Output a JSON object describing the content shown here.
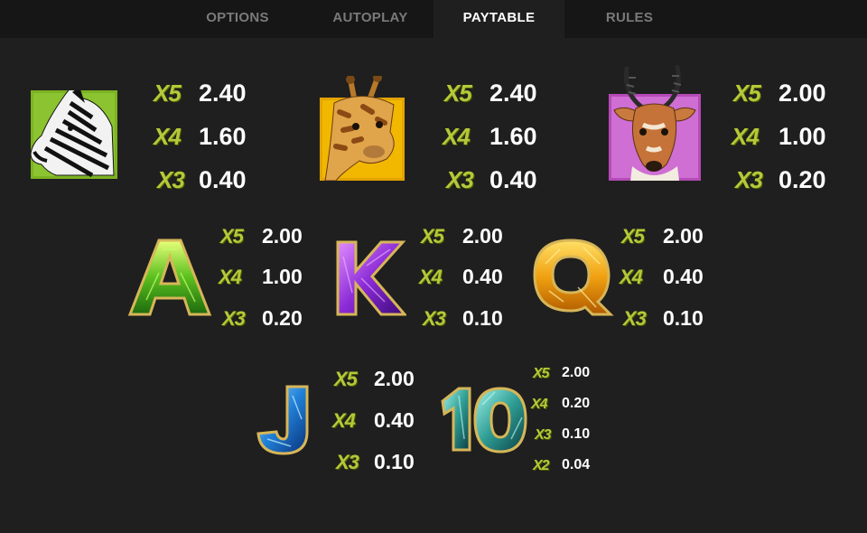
{
  "tabs": [
    {
      "label": "OPTIONS"
    },
    {
      "label": "AUTOPLAY"
    },
    {
      "label": "PAYTABLE",
      "active": true
    },
    {
      "label": "RULES"
    }
  ],
  "symbols": {
    "zebra": {
      "pays": [
        {
          "mult": "X5",
          "value": "2.40"
        },
        {
          "mult": "X4",
          "value": "1.60"
        },
        {
          "mult": "X3",
          "value": "0.40"
        }
      ]
    },
    "giraffe": {
      "pays": [
        {
          "mult": "X5",
          "value": "2.40"
        },
        {
          "mult": "X4",
          "value": "1.60"
        },
        {
          "mult": "X3",
          "value": "0.40"
        }
      ]
    },
    "antelope": {
      "pays": [
        {
          "mult": "X5",
          "value": "2.00"
        },
        {
          "mult": "X4",
          "value": "1.00"
        },
        {
          "mult": "X3",
          "value": "0.20"
        }
      ]
    },
    "ace": {
      "glyph": "A",
      "pays": [
        {
          "mult": "X5",
          "value": "2.00"
        },
        {
          "mult": "X4",
          "value": "1.00"
        },
        {
          "mult": "X3",
          "value": "0.20"
        }
      ]
    },
    "king": {
      "glyph": "K",
      "pays": [
        {
          "mult": "X5",
          "value": "2.00"
        },
        {
          "mult": "X4",
          "value": "0.40"
        },
        {
          "mult": "X3",
          "value": "0.10"
        }
      ]
    },
    "queen": {
      "glyph": "Q",
      "pays": [
        {
          "mult": "X5",
          "value": "2.00"
        },
        {
          "mult": "X4",
          "value": "0.40"
        },
        {
          "mult": "X3",
          "value": "0.10"
        }
      ]
    },
    "jack": {
      "glyph": "J",
      "pays": [
        {
          "mult": "X5",
          "value": "2.00"
        },
        {
          "mult": "X4",
          "value": "0.40"
        },
        {
          "mult": "X3",
          "value": "0.10"
        }
      ]
    },
    "ten": {
      "glyph": "10",
      "pays": [
        {
          "mult": "X5",
          "value": "2.00"
        },
        {
          "mult": "X4",
          "value": "0.20"
        },
        {
          "mult": "X3",
          "value": "0.10"
        },
        {
          "mult": "X2",
          "value": "0.04"
        }
      ]
    }
  },
  "colors": {
    "background": "#1f1f1f",
    "tabbar": "#161616",
    "multiplier": "#b6c83a",
    "zebra_frame": "#7bb321",
    "giraffe_frame": "#e3a400",
    "antelope_frame": "#b64ab8"
  }
}
